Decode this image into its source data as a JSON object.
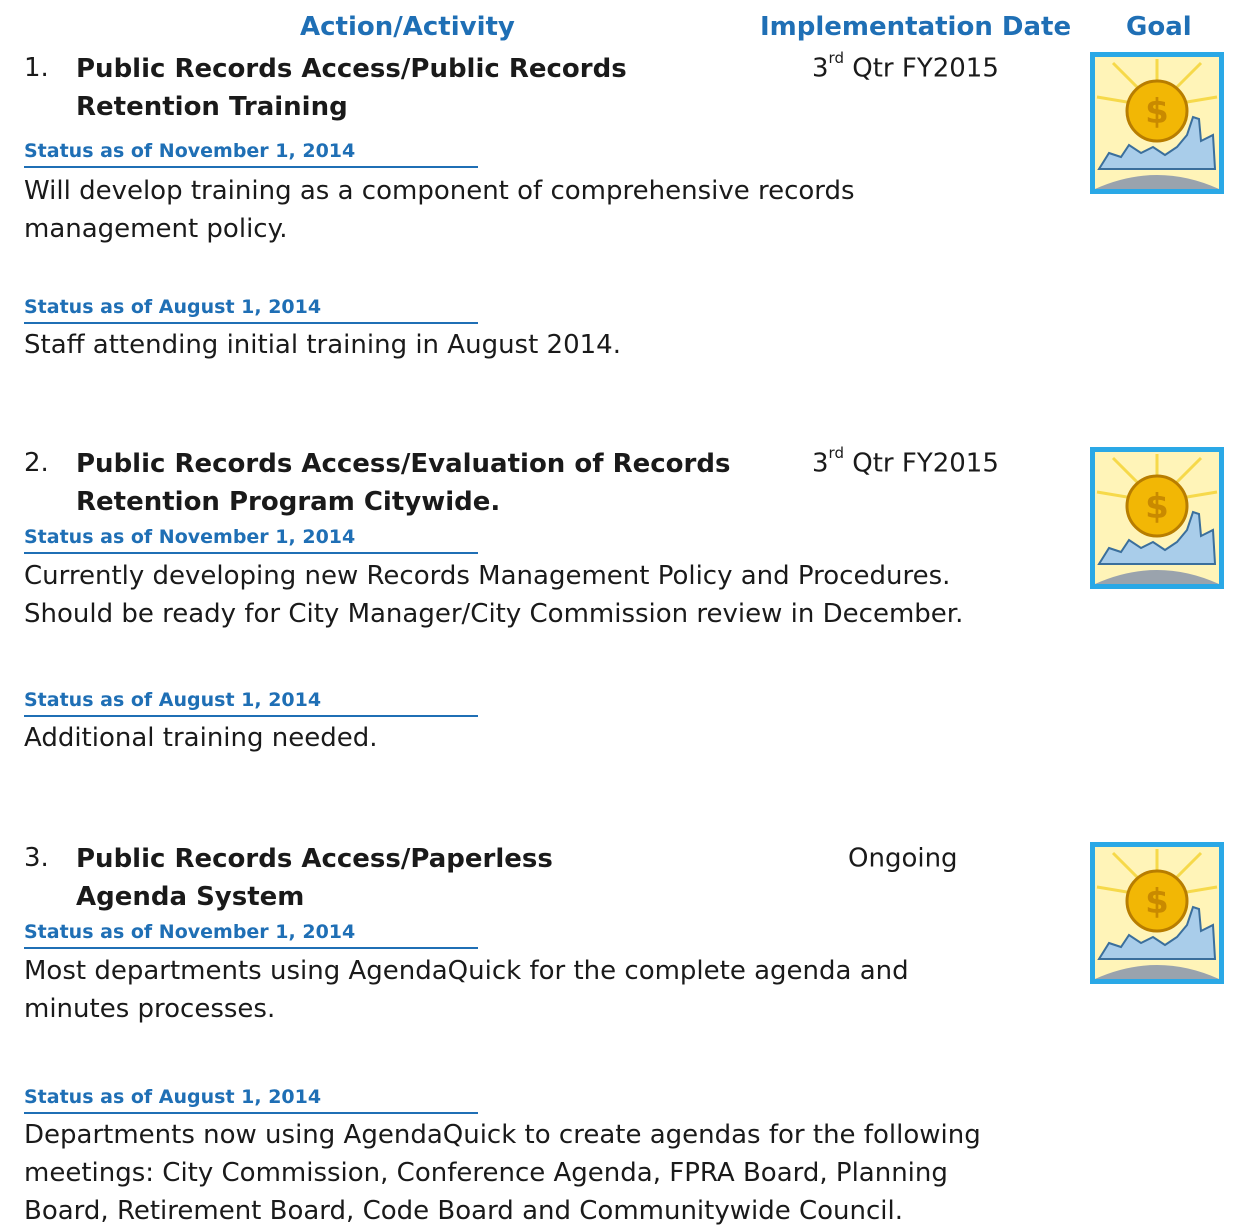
{
  "header": {
    "action": "Action/Activity",
    "implementation_date": "Implementation Date",
    "goal": "Goal"
  },
  "items": [
    {
      "number": "1.",
      "title": "Public Records Access/Public Records Retention Training",
      "date_prefix": "3",
      "date_sup": "rd",
      "date_suffix": " Qtr FY2015",
      "statuses": [
        {
          "label": "Status as of November 1, 2014",
          "text": "Will develop training as a component of comprehensive records management policy."
        },
        {
          "label": "Status as of August 1, 2014",
          "text": "Staff attending initial training in August 2014."
        }
      ],
      "goal_icon": "economic-development-icon"
    },
    {
      "number": "2.",
      "title": "Public Records Access/Evaluation of Records Retention Program Citywide.",
      "date_prefix": "3",
      "date_sup": "rd",
      "date_suffix": " Qtr FY2015",
      "statuses": [
        {
          "label": "Status as of November 1, 2014",
          "text": "Currently developing new Records Management Policy and Procedures. Should be ready for City Manager/City Commission review in December."
        },
        {
          "label": "Status as of August 1, 2014",
          "text": "Additional training needed."
        }
      ],
      "goal_icon": "economic-development-icon"
    },
    {
      "number": "3.",
      "title": "Public Records Access/Paperless Agenda System",
      "date_prefix": "Ongoing",
      "date_sup": "",
      "date_suffix": "",
      "statuses": [
        {
          "label": "Status as of November 1, 2014",
          "text": "Most departments using AgendaQuick for the complete agenda and minutes processes."
        },
        {
          "label": "Status as of August 1, 2014",
          "text": "Departments now using AgendaQuick to create agendas for the following meetings:  City Commission, Conference Agenda, FPRA Board, Planning Board, Retirement Board, Code Board and Communitywide Council."
        }
      ],
      "goal_icon": "economic-development-icon"
    }
  ],
  "colors": {
    "accent": "#1f6fb5",
    "icon_border": "#2aa8e6",
    "coin": "#f2b705"
  }
}
